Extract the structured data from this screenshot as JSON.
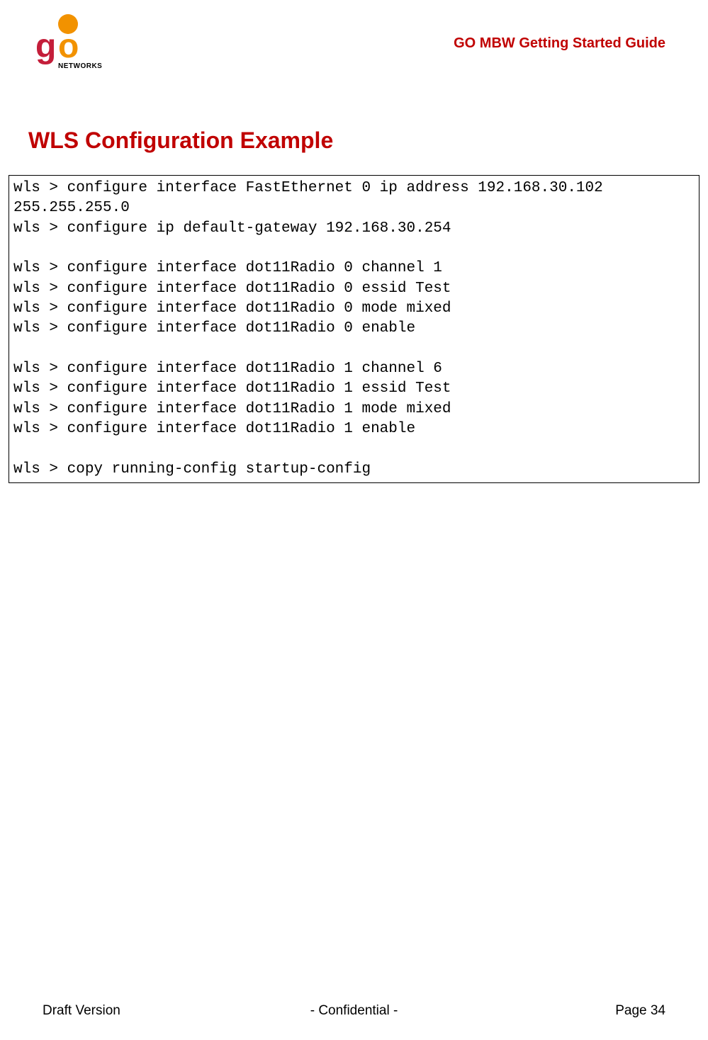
{
  "header": {
    "guide_title": "GO MBW Getting Started Guide",
    "logo_networks_text": "NETWORKS"
  },
  "section": {
    "heading": "WLS Configuration Example"
  },
  "code": {
    "content": "wls > configure interface FastEthernet 0 ip address 192.168.30.102 255.255.255.0\nwls > configure ip default-gateway 192.168.30.254\n\nwls > configure interface dot11Radio 0 channel 1\nwls > configure interface dot11Radio 0 essid Test\nwls > configure interface dot11Radio 0 mode mixed\nwls > configure interface dot11Radio 0 enable\n\nwls > configure interface dot11Radio 1 channel 6\nwls > configure interface dot11Radio 1 essid Test\nwls > configure interface dot11Radio 1 mode mixed\nwls > configure interface dot11Radio 1 enable\n\nwls > copy running-config startup-config"
  },
  "footer": {
    "left": "Draft Version",
    "center": "-  Confidential  -",
    "right": "Page 34"
  }
}
